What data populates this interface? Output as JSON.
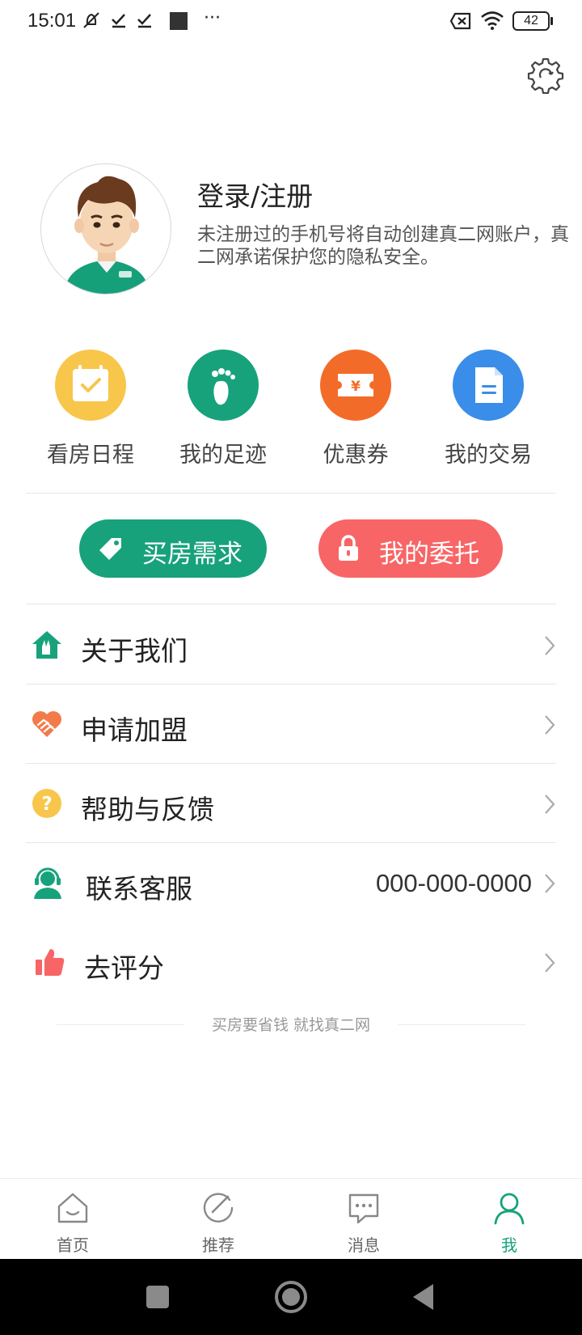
{
  "status_bar": {
    "time": "15:01",
    "battery": "42",
    "icons": [
      "mute-icon",
      "check-icon",
      "check-icon",
      "square-icon",
      "more-dots-icon",
      "sim-off-icon",
      "wifi-icon",
      "battery-icon"
    ]
  },
  "header": {
    "settings_icon": "gear-icon"
  },
  "profile": {
    "login_label": "登录/注册",
    "description": "未注册过的手机号将自动创建真二网账户，真二网承诺保护您的隐私安全。"
  },
  "quick_actions": [
    {
      "label": "看房日程",
      "icon": "calendar-check-icon",
      "color": "#f8c64a"
    },
    {
      "label": "我的足迹",
      "icon": "footprint-icon",
      "color": "#17a27c"
    },
    {
      "label": "优惠券",
      "icon": "coupon-icon",
      "color": "#f36b28"
    },
    {
      "label": "我的交易",
      "icon": "document-icon",
      "color": "#3a8de8"
    }
  ],
  "actions": {
    "buy_demand": {
      "label": "买房需求",
      "color": "#17a27c",
      "icon": "tag-icon"
    },
    "my_entrust": {
      "label": "我的委托",
      "color": "#f86566",
      "icon": "lock-icon"
    }
  },
  "menu": {
    "about": {
      "label": "关于我们",
      "icon": "house-hand-icon"
    },
    "join": {
      "label": "申请加盟",
      "icon": "handshake-heart-icon"
    },
    "help": {
      "label": "帮助与反馈",
      "icon": "question-icon"
    },
    "service": {
      "label": "联系客服",
      "value": "000-000-0000",
      "icon": "headset-icon"
    },
    "rate": {
      "label": "去评分",
      "icon": "thumbs-up-icon"
    }
  },
  "footer": {
    "slogan": "买房要省钱 就找真二网"
  },
  "tabs": [
    {
      "label": "首页",
      "icon": "home-icon",
      "active": false
    },
    {
      "label": "推荐",
      "icon": "recommend-icon",
      "active": false
    },
    {
      "label": "消息",
      "icon": "message-icon",
      "active": false
    },
    {
      "label": "我",
      "icon": "user-icon",
      "active": true
    }
  ],
  "colors": {
    "accent": "#17a27c",
    "inactive_tab": "#666666"
  }
}
